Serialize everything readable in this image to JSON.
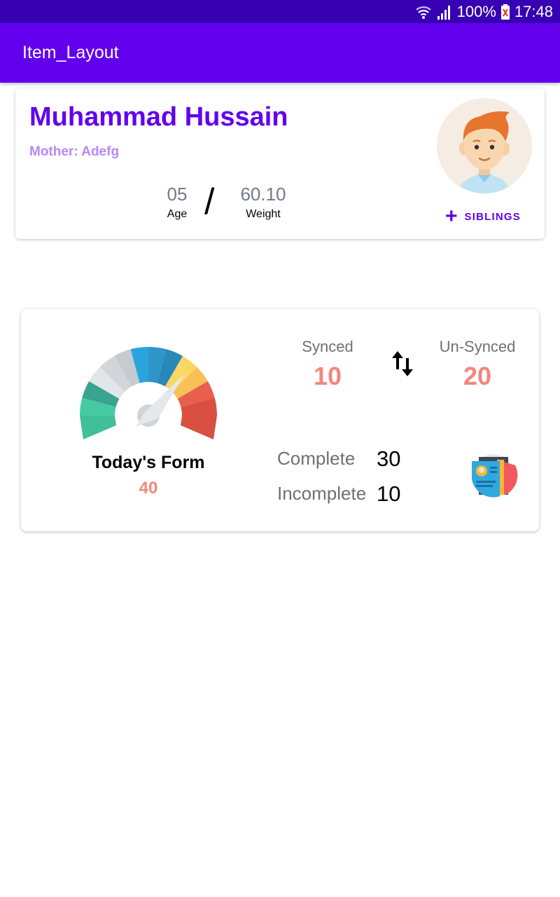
{
  "status_bar": {
    "battery": "100%",
    "time": "17:48"
  },
  "app_bar": {
    "title": "Item_Layout"
  },
  "profile": {
    "name": "Muhammad Hussain",
    "mother": "Mother: Adefg",
    "age_value": "05",
    "age_label": "Age",
    "divider": "/",
    "weight_value": "60.10",
    "weight_label": "Weight",
    "siblings_label": "SIBLINGS"
  },
  "stats": {
    "form_title": "Today's Form",
    "form_count": "40",
    "synced_label": "Synced",
    "synced_count": "10",
    "unsynced_label": "Un-Synced",
    "unsynced_count": "20",
    "complete_label": "Complete",
    "complete_count": "30",
    "incomplete_label": "Incomplete",
    "incomplete_count": "10"
  },
  "icons": {
    "wifi": "wifi-icon",
    "signal": "signal-icon",
    "battery": "battery-icon",
    "avatar": "boy-avatar",
    "add": "plus-icon",
    "gauge": "speedometer-icon",
    "sync": "swap-vertical-icon",
    "form": "id-card-icon"
  },
  "colors": {
    "status_bar": "#3700b3",
    "primary": "#6200ee",
    "accent_light": "#bb86fc",
    "count": "#f1877b"
  }
}
